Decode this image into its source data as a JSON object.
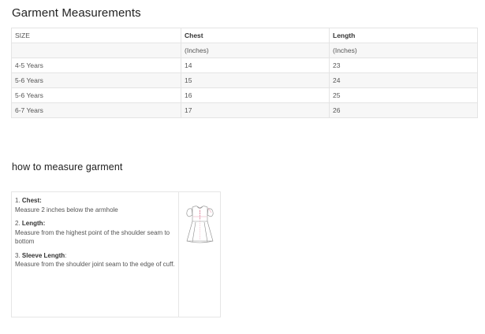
{
  "page": {
    "title": "Garment Measurements",
    "subtitle": "how to measure garment"
  },
  "size_table": {
    "headers": [
      "SIZE",
      "Chest",
      "Length"
    ],
    "units": [
      "",
      "(Inches)",
      "(Inches)"
    ],
    "rows": [
      [
        "4-5 Years",
        "14",
        "23"
      ],
      [
        "5-6 Years",
        "15",
        "24"
      ],
      [
        "5-6 Years",
        "16",
        "25"
      ],
      [
        "6-7 Years",
        "17",
        "26"
      ]
    ]
  },
  "how_to": {
    "steps": [
      {
        "num": "1. ",
        "label": "Chest",
        "punct": ":",
        "desc": "Measure 2 inches below the armhole"
      },
      {
        "num": "2. ",
        "label": "Length",
        "punct": ":",
        "desc": "Measure from the highest point of the shoulder seam to bottom"
      },
      {
        "num": "3. ",
        "label": "Sleeve Length",
        "punct": ":",
        "desc": "Measure from the shoulder joint seam to the edge of cuff."
      }
    ],
    "illustration": "dress-diagram-icon"
  }
}
